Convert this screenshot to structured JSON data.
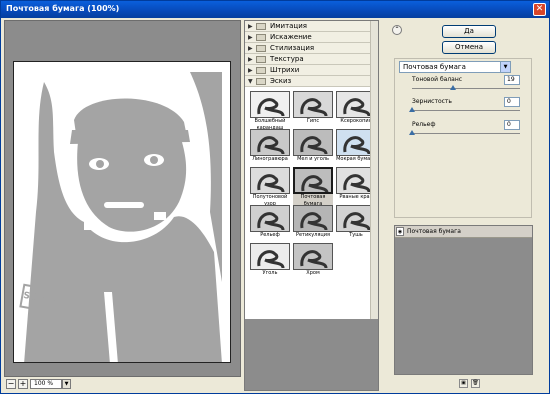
{
  "window": {
    "title": "Почтовая бумага (100%)",
    "close_glyph": "✕"
  },
  "preview": {
    "stamp_text": "SECURITY",
    "zoom_minus": "−",
    "zoom_plus": "+",
    "zoom_value": "100 %",
    "zoom_arrow": "▼"
  },
  "gallery": {
    "categories": [
      {
        "label": "Имитация",
        "expanded": false
      },
      {
        "label": "Искажение",
        "expanded": false
      },
      {
        "label": "Стилизация",
        "expanded": false
      },
      {
        "label": "Текстура",
        "expanded": false
      },
      {
        "label": "Штрихи",
        "expanded": false
      },
      {
        "label": "Эскиз",
        "expanded": true
      }
    ],
    "thumbnails": [
      {
        "label": "Волшебный карандаш",
        "selected": false
      },
      {
        "label": "Гипс",
        "selected": false
      },
      {
        "label": "Ксерокопия",
        "selected": false
      },
      {
        "label": "Линогравюра",
        "selected": false
      },
      {
        "label": "Мел и уголь",
        "selected": false
      },
      {
        "label": "Мокрая бумага",
        "selected": false
      },
      {
        "label": "Полутоновой узор",
        "selected": false
      },
      {
        "label": "Почтовая бумага",
        "selected": true
      },
      {
        "label": "Рваные края",
        "selected": false
      },
      {
        "label": "Рельеф",
        "selected": false
      },
      {
        "label": "Ретикуляция",
        "selected": false
      },
      {
        "label": "Тушь",
        "selected": false
      },
      {
        "label": "Уголь",
        "selected": false
      },
      {
        "label": "Хром",
        "selected": false
      }
    ]
  },
  "buttons": {
    "ok": "Да",
    "cancel": "Отмена",
    "collapse_glyph": "⌃"
  },
  "settings": {
    "filter_select": "Почтовая бумага",
    "dropdown_glyph": "▼",
    "params": [
      {
        "label": "Тоновой баланс",
        "value": "19",
        "fraction": 0.38
      },
      {
        "label": "Зернистость",
        "value": "0",
        "fraction": 0.0
      },
      {
        "label": "Рельеф",
        "value": "0",
        "fraction": 0.0
      }
    ]
  },
  "layers": {
    "items": [
      {
        "label": "Почтовая бумага"
      }
    ],
    "eye_glyph": "◉",
    "new_glyph": "▣",
    "delete_glyph": "🗑"
  },
  "colors": {
    "title_bar": "#0a5fdc",
    "panel": "#ece9d8",
    "preview_bg": "#8c8c8c",
    "image_gray": "#a4a4a4"
  }
}
